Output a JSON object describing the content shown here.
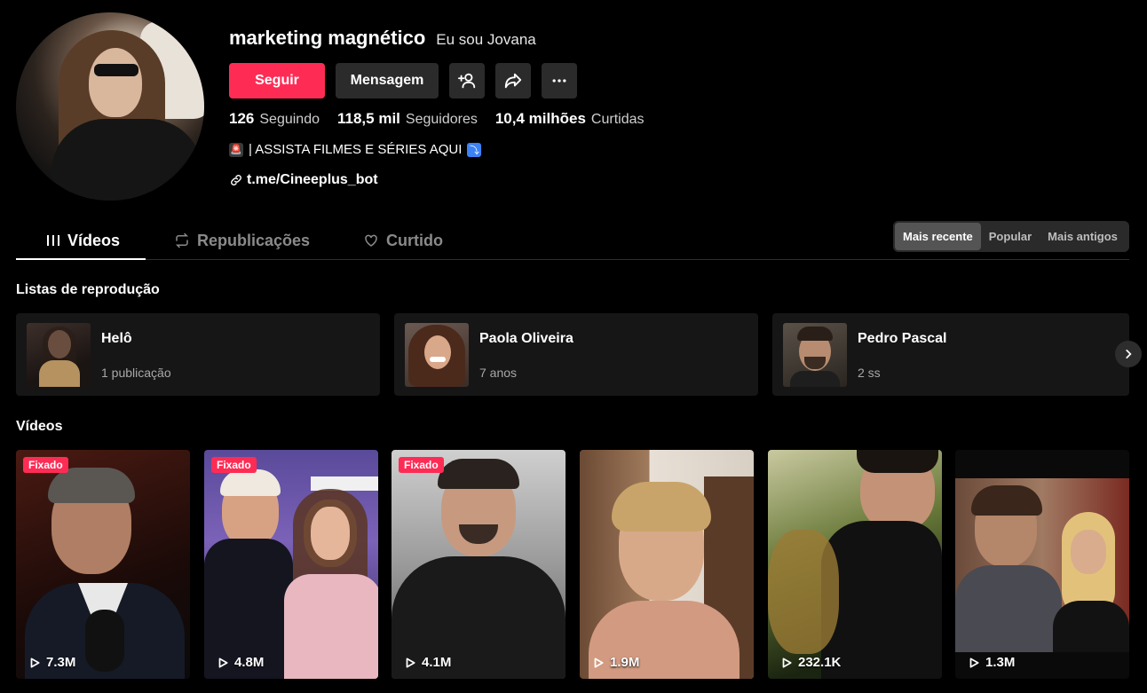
{
  "profile": {
    "username": "marketing magnético",
    "nickname": "Eu sou Jovana",
    "follow_label": "Seguir",
    "message_label": "Mensagem",
    "stats": [
      {
        "value": "126",
        "label": "Seguindo"
      },
      {
        "value": "118,5 mil",
        "label": "Seguidores"
      },
      {
        "value": "10,4 milhões",
        "label": "Curtidas"
      }
    ],
    "bio": "| ASSISTA FILMES E SÉRIES AQUI",
    "link": "t.me/Cineeplus_bot"
  },
  "tabs": [
    {
      "label": "Vídeos",
      "icon": "grid-icon",
      "active": true
    },
    {
      "label": "Republicações",
      "icon": "repost-icon",
      "active": false
    },
    {
      "label": "Curtido",
      "icon": "heart-icon",
      "active": false
    }
  ],
  "sort": [
    {
      "label": "Mais recente",
      "active": true
    },
    {
      "label": "Popular",
      "active": false
    },
    {
      "label": "Mais antigos",
      "active": false
    }
  ],
  "playlists_title": "Listas de reprodução",
  "playlists": [
    {
      "name": "Helô",
      "sub": "1 publicação"
    },
    {
      "name": "Paola Oliveira",
      "sub": "7 anos"
    },
    {
      "name": "Pedro Pascal",
      "sub": "2 ss"
    }
  ],
  "videos_title": "Vídeos",
  "videos": [
    {
      "views": "7.3M",
      "pinned": true,
      "badge": "Fixado"
    },
    {
      "views": "4.8M",
      "pinned": true,
      "badge": "Fixado"
    },
    {
      "views": "4.1M",
      "pinned": true,
      "badge": "Fixado"
    },
    {
      "views": "1.9M",
      "pinned": false
    },
    {
      "views": "232.1K",
      "pinned": false
    },
    {
      "views": "1.3M",
      "pinned": false
    }
  ],
  "colors": {
    "accent": "#fe2c55",
    "background": "#000000",
    "card": "#161616"
  }
}
